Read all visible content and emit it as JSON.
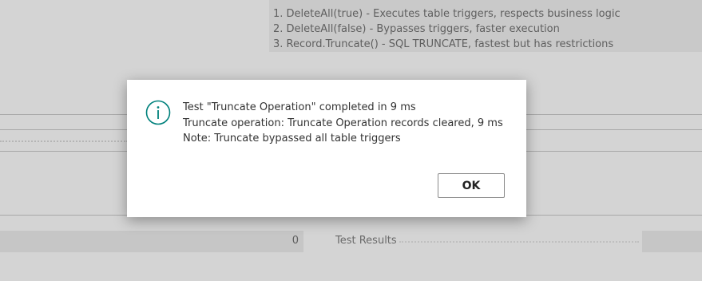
{
  "background": {
    "info_lines": [
      "1. DeleteAll(true) - Executes table triggers, respects business logic",
      "2. DeleteAll(false) - Bypasses triggers, faster execution",
      "3. Record.Truncate() - SQL TRUNCATE, fastest but has restrictions"
    ],
    "count_value": "0",
    "results_label": "Test Results"
  },
  "dialog": {
    "icon": "info-icon",
    "accent_color": "#00817c",
    "lines": [
      "Test \"Truncate Operation\" completed in 9 ms",
      "Truncate operation: Truncate Operation records cleared, 9 ms",
      "Note: Truncate bypassed all table triggers"
    ],
    "ok_label": "OK"
  }
}
